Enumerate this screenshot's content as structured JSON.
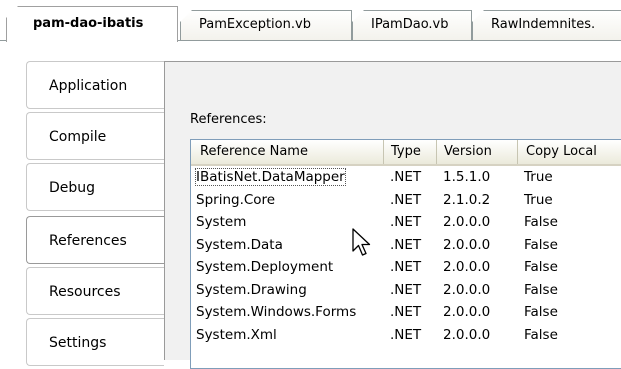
{
  "tabs": [
    {
      "label": "pam-dao-ibatis",
      "active": true
    },
    {
      "label": "PamException.vb",
      "active": false
    },
    {
      "label": "IPamDao.vb",
      "active": false
    },
    {
      "label": "RawIndemnites.",
      "active": false
    }
  ],
  "nav": {
    "items": [
      {
        "label": "Application"
      },
      {
        "label": "Compile"
      },
      {
        "label": "Debug"
      },
      {
        "label": "References",
        "selected": true
      },
      {
        "label": "Resources"
      },
      {
        "label": "Settings"
      }
    ]
  },
  "references": {
    "label": "References:",
    "columns": [
      "Reference Name",
      "Type",
      "Version",
      "Copy Local"
    ],
    "rows": [
      [
        "IBatisNet.DataMapper",
        ".NET",
        "1.5.1.0",
        "True"
      ],
      [
        "Spring.Core",
        ".NET",
        "2.1.0.2",
        "True"
      ],
      [
        "System",
        ".NET",
        "2.0.0.0",
        "False"
      ],
      [
        "System.Data",
        ".NET",
        "2.0.0.0",
        "False"
      ],
      [
        "System.Deployment",
        ".NET",
        "2.0.0.0",
        "False"
      ],
      [
        "System.Drawing",
        ".NET",
        "2.0.0.0",
        "False"
      ],
      [
        "System.Windows.Forms",
        ".NET",
        "2.0.0.0",
        "False"
      ],
      [
        "System.Xml",
        ".NET",
        "2.0.0.0",
        "False"
      ]
    ]
  },
  "colors": {
    "border": "#919b9c",
    "page_bg": "#f1f1f1",
    "list_border": "#7f9db9"
  },
  "icons": {
    "cursor": "mouse-pointer-icon"
  }
}
